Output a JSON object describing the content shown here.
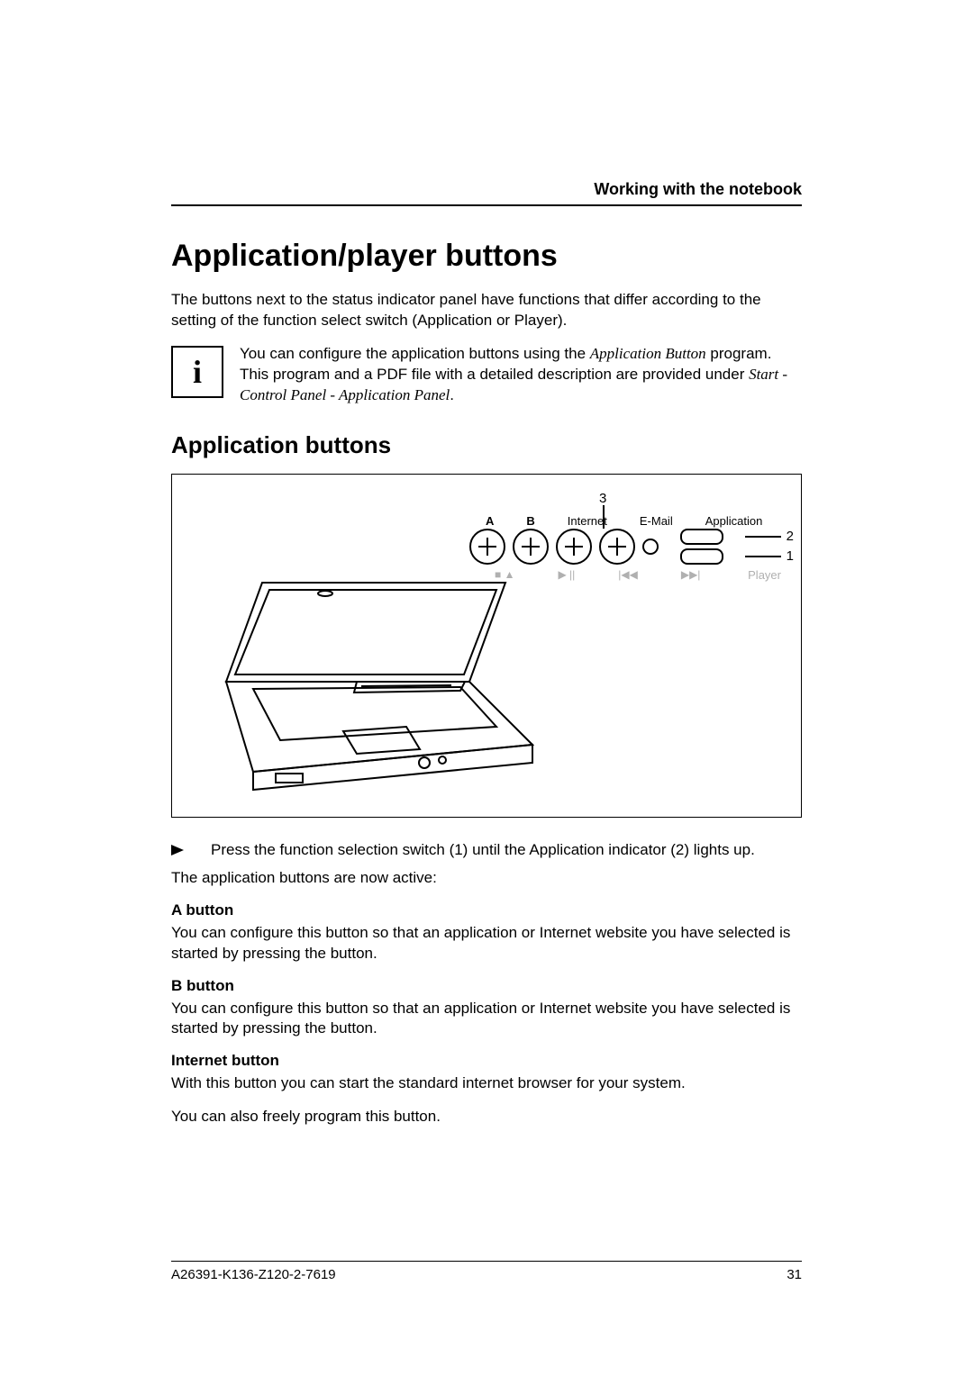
{
  "runningHead": "Working with the notebook",
  "heading1": "Application/player buttons",
  "intro": "The buttons next to the status indicator panel have functions that differ according to the setting of the function select switch (Application or Player).",
  "info": {
    "pre": "You can configure the application buttons using the ",
    "em1": "Application Button",
    "mid": " program. This program and a PDF file with a detailed description are provided under ",
    "em2": "Start - Control Panel - Application Panel",
    "post": "."
  },
  "heading2": "Application buttons",
  "figure": {
    "labels": {
      "a": "A",
      "b": "B",
      "internet": "Internet",
      "email": "E-Mail",
      "application": "Application",
      "playerLabel": "Player"
    },
    "playerIcons": {
      "stop": "■ ▲",
      "playpause": "▶ ||",
      "prev": "|◀◀",
      "next": "▶▶|"
    },
    "callouts": {
      "c1": "1",
      "c2": "2",
      "c3": "3"
    }
  },
  "step1": "Press the function selection switch (1) until the Application indicator (2) lights up.",
  "afterStep": "The application buttons are now active:",
  "aButton": {
    "title": "A button",
    "text": "You can configure this button so that an application or Internet website you have selected is started by pressing the button."
  },
  "bButton": {
    "title": "B button",
    "text": "You can configure this button so that an application or Internet website you have selected is started by pressing the button."
  },
  "internetButton": {
    "title": "Internet button",
    "line1": "With this button you can start the standard internet browser for your system.",
    "line2": "You can also freely program this button."
  },
  "footer": {
    "docId": "A26391-K136-Z120-2-7619",
    "pageNum": "31"
  }
}
